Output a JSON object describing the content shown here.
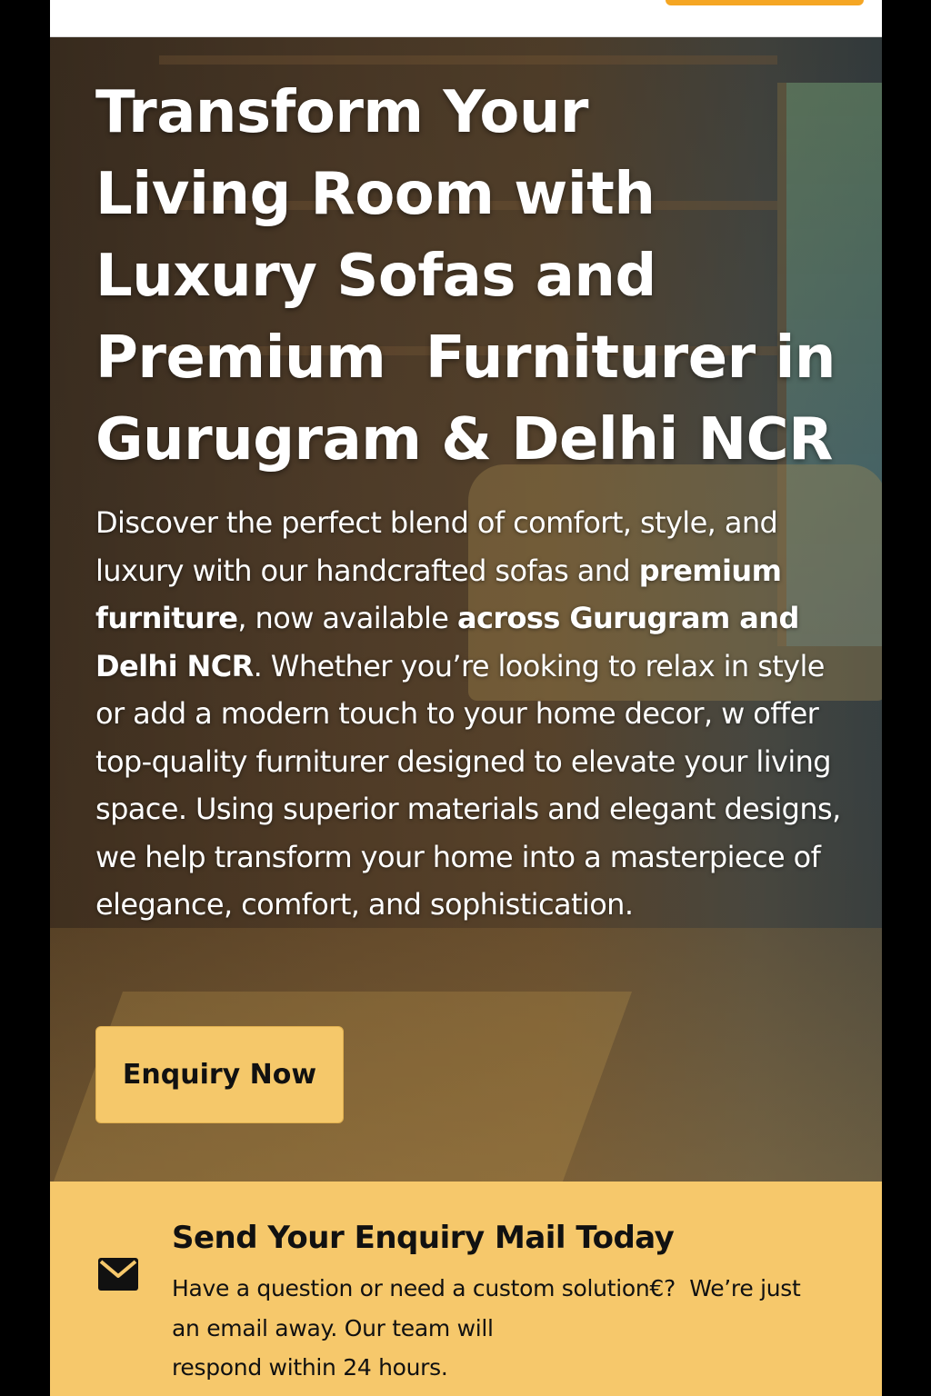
{
  "header": {
    "cta_color": "#f5a623"
  },
  "hero": {
    "title_lines": [
      "Transform Your",
      "Living Room with",
      "Luxury Sofas and",
      "Premium  Furniturer in",
      "Gurugram & Delhi NCR"
    ],
    "description": {
      "part1": "Discover the perfect blend of comfort, style, and luxury with our handcrafted sofas and ",
      "bold1": "premium furniture",
      "part2": ", now available ",
      "bold2": "across Gurugram and Delhi NCR",
      "part3": ". Whether you’re looking to relax in style or add a modern touch to your home decor, w offer top-quality furniturer designed to elevate your living space. Using superior materials and elegant designs, we help transform your home into a masterpiece of elegance, comfort, and sophistication."
    },
    "button_label": "Enquiry Now",
    "button_color": "#f5c86a"
  },
  "enquiry": {
    "icon": "mail-icon",
    "title": "Send Your Enquiry Mail Today",
    "text_line1": "Have a question or need a custom solution€?  We’re just",
    "text_line2": "an email away. Our team will",
    "text_line3": "respond within 24 hours.",
    "background_color": "#f6c86b"
  }
}
